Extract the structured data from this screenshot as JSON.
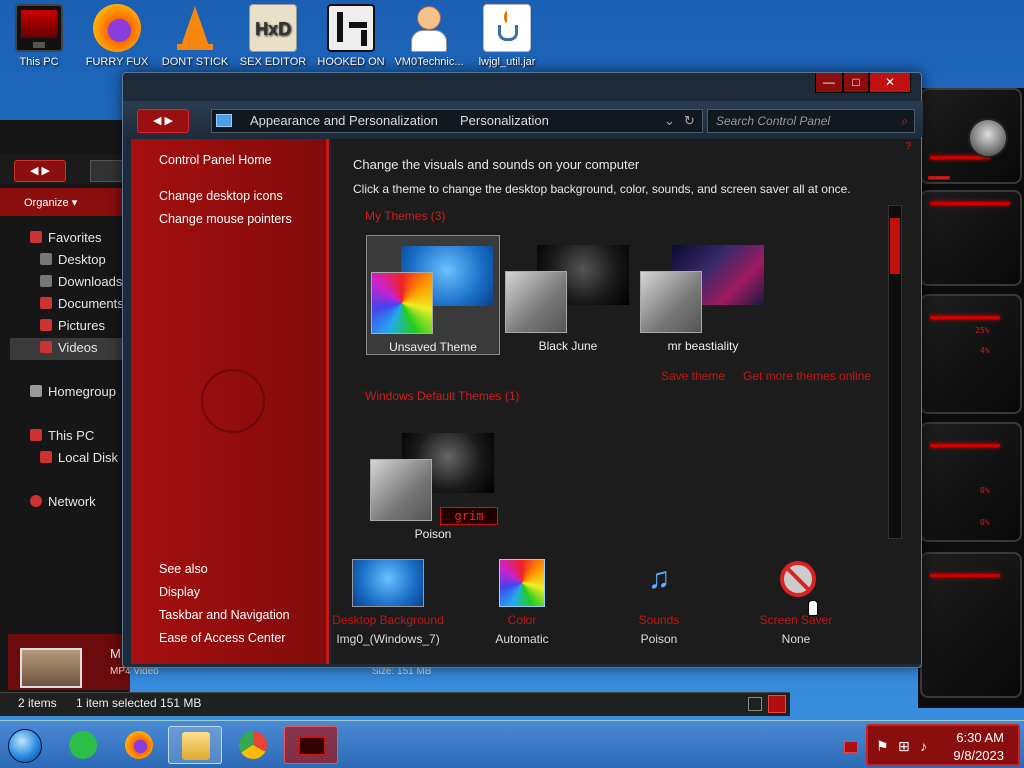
{
  "desktop": {
    "icons": [
      {
        "label": "This PC"
      },
      {
        "label": "FURRY FUX"
      },
      {
        "label": "DONT STICK"
      },
      {
        "label": "SEX EDITOR"
      },
      {
        "label": "HOOKED ON"
      },
      {
        "label": "VM0Technic..."
      },
      {
        "label": "lwjgl_util.jar"
      }
    ]
  },
  "window": {
    "breadcrumb": [
      "Appearance and Personalization",
      "Personalization"
    ],
    "search_placeholder": "Search Control Panel",
    "nav_back": "◀",
    "nav_fwd": "▶",
    "btn_min": "—",
    "btn_max": "□",
    "btn_close": "✕"
  },
  "sidebar": {
    "home": "Control Panel Home",
    "links": [
      "Change desktop icons",
      "Change mouse pointers"
    ],
    "see_also_title": "See also",
    "see_also": [
      "Display",
      "Taskbar and Navigation",
      "Ease of Access Center"
    ]
  },
  "content": {
    "heading": "Change the visuals and sounds on your computer",
    "subheading": "Click a theme to change the desktop background, color, sounds, and screen saver all at once.",
    "my_themes_title": "My Themes (3)",
    "my_themes": [
      "Unsaved Theme",
      "Black June",
      "mr beastiality"
    ],
    "save_theme": "Save theme",
    "get_more": "Get more themes online",
    "default_themes_title": "Windows Default Themes (1)",
    "default_themes": [
      "Poison"
    ],
    "poison_badge": "grim",
    "bottom": [
      {
        "label": "Desktop Background",
        "value": "Img0_(Windows_7)"
      },
      {
        "label": "Color",
        "value": "Automatic"
      },
      {
        "label": "Sounds",
        "value": "Poison"
      },
      {
        "label": "Screen Saver",
        "value": "None"
      }
    ]
  },
  "explorer": {
    "organize": "Organize ▾",
    "tree": [
      "Favorites",
      "Desktop",
      "Downloads",
      "Documents",
      "Pictures",
      "Videos",
      "Homegroup",
      "This PC",
      "Local Disk",
      "Network"
    ],
    "status_items": "2 items",
    "status_selected": "1 item selected  151 MB",
    "file_name": "M",
    "file_type": "MP4 Video",
    "file_size": "Size:  151 MB"
  },
  "taskbar": {
    "time": "6:30 AM",
    "date": "9/8/2023"
  },
  "colors": {
    "accent_red": "#c01010",
    "sidebar_red": "#a50f0f",
    "link_red": "#c71515",
    "content_bg": "#1c1c1c",
    "taskbar_blue": "#2d6ab6"
  }
}
